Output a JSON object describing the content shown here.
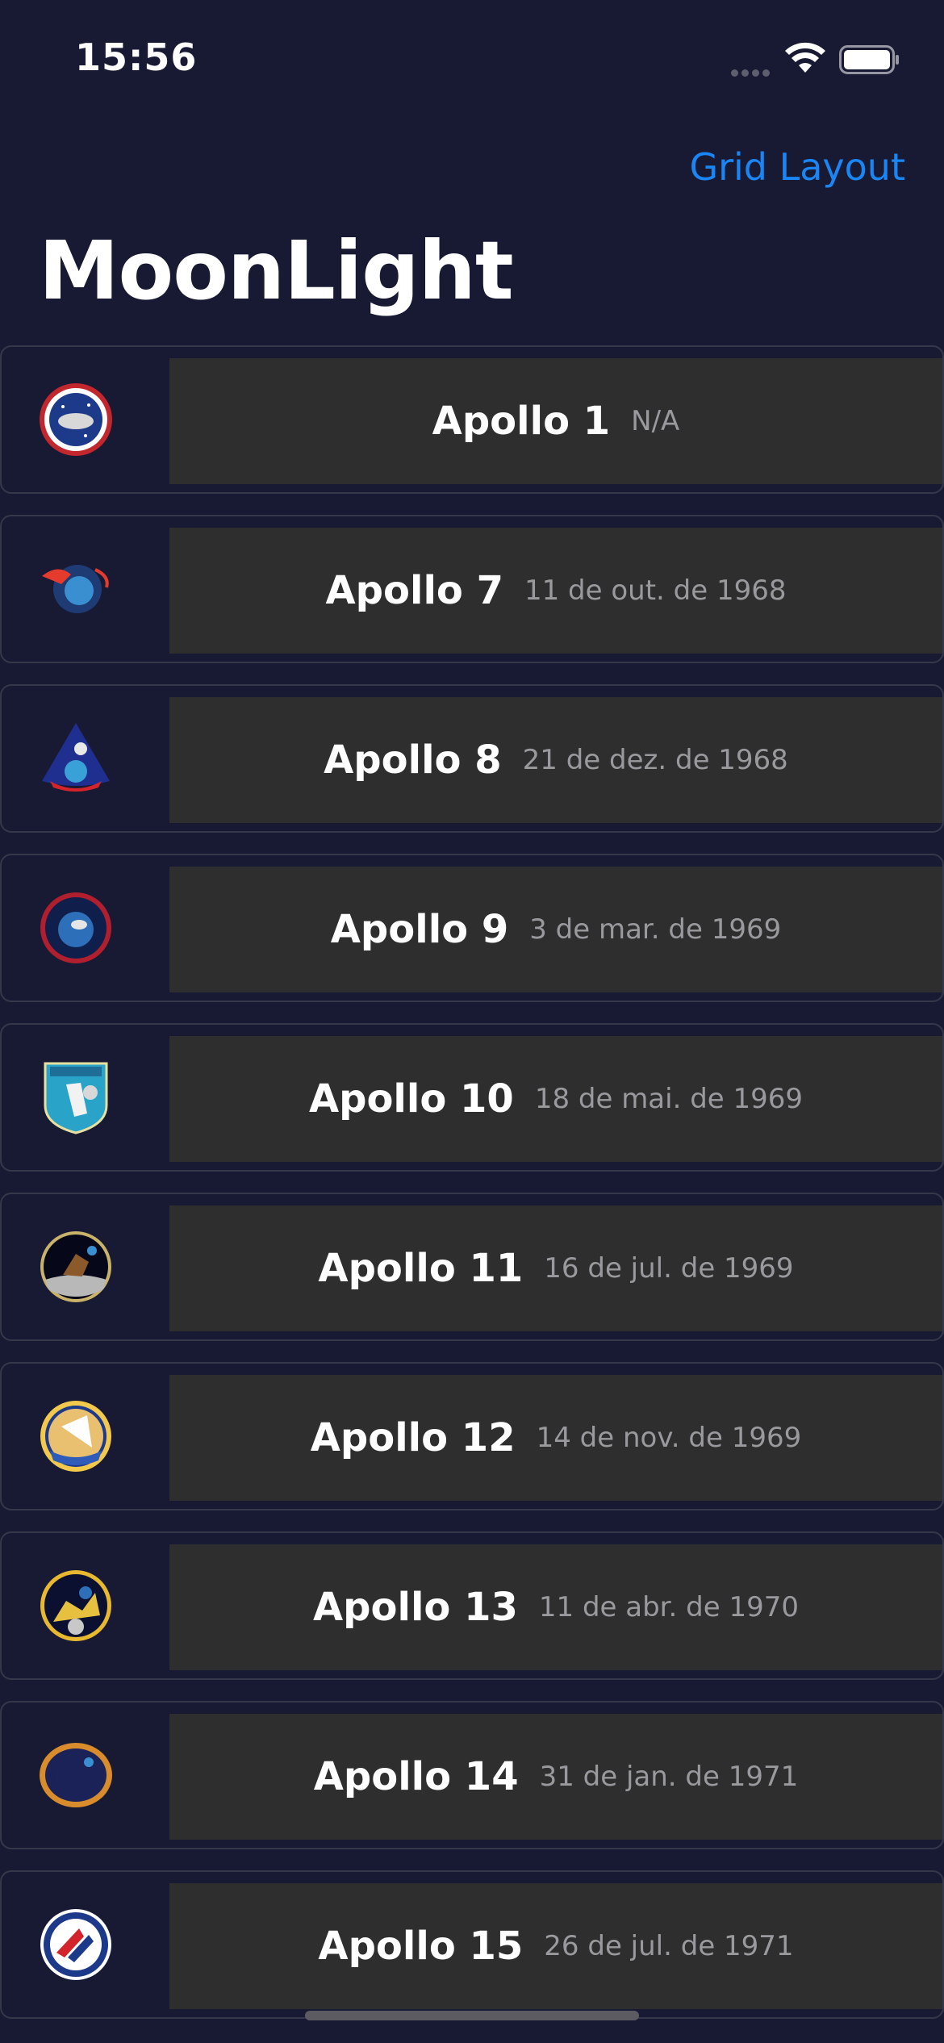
{
  "status_bar": {
    "time": "15:56"
  },
  "nav": {
    "action_label": "Grid Layout",
    "title": "MoonLight"
  },
  "missions": [
    {
      "name": "Apollo 1",
      "date": "N/A",
      "patch": "apollo-1-patch-icon"
    },
    {
      "name": "Apollo 7",
      "date": "11 de out. de 1968",
      "patch": "apollo-7-patch-icon"
    },
    {
      "name": "Apollo 8",
      "date": "21 de dez. de 1968",
      "patch": "apollo-8-patch-icon"
    },
    {
      "name": "Apollo 9",
      "date": "3 de mar. de 1969",
      "patch": "apollo-9-patch-icon"
    },
    {
      "name": "Apollo 10",
      "date": "18 de mai. de 1969",
      "patch": "apollo-10-patch-icon"
    },
    {
      "name": "Apollo 11",
      "date": "16 de jul. de 1969",
      "patch": "apollo-11-patch-icon"
    },
    {
      "name": "Apollo 12",
      "date": "14 de nov. de 1969",
      "patch": "apollo-12-patch-icon"
    },
    {
      "name": "Apollo 13",
      "date": "11 de abr. de 1970",
      "patch": "apollo-13-patch-icon"
    },
    {
      "name": "Apollo 14",
      "date": "31 de jan. de 1971",
      "patch": "apollo-14-patch-icon"
    },
    {
      "name": "Apollo 15",
      "date": "26 de jul. de 1971",
      "patch": "apollo-15-patch-icon"
    }
  ],
  "colors": {
    "background": "#181a33",
    "row_panel": "#2e2e2f",
    "accent": "#1a86f5",
    "secondary_text": "#9a9a9e"
  }
}
